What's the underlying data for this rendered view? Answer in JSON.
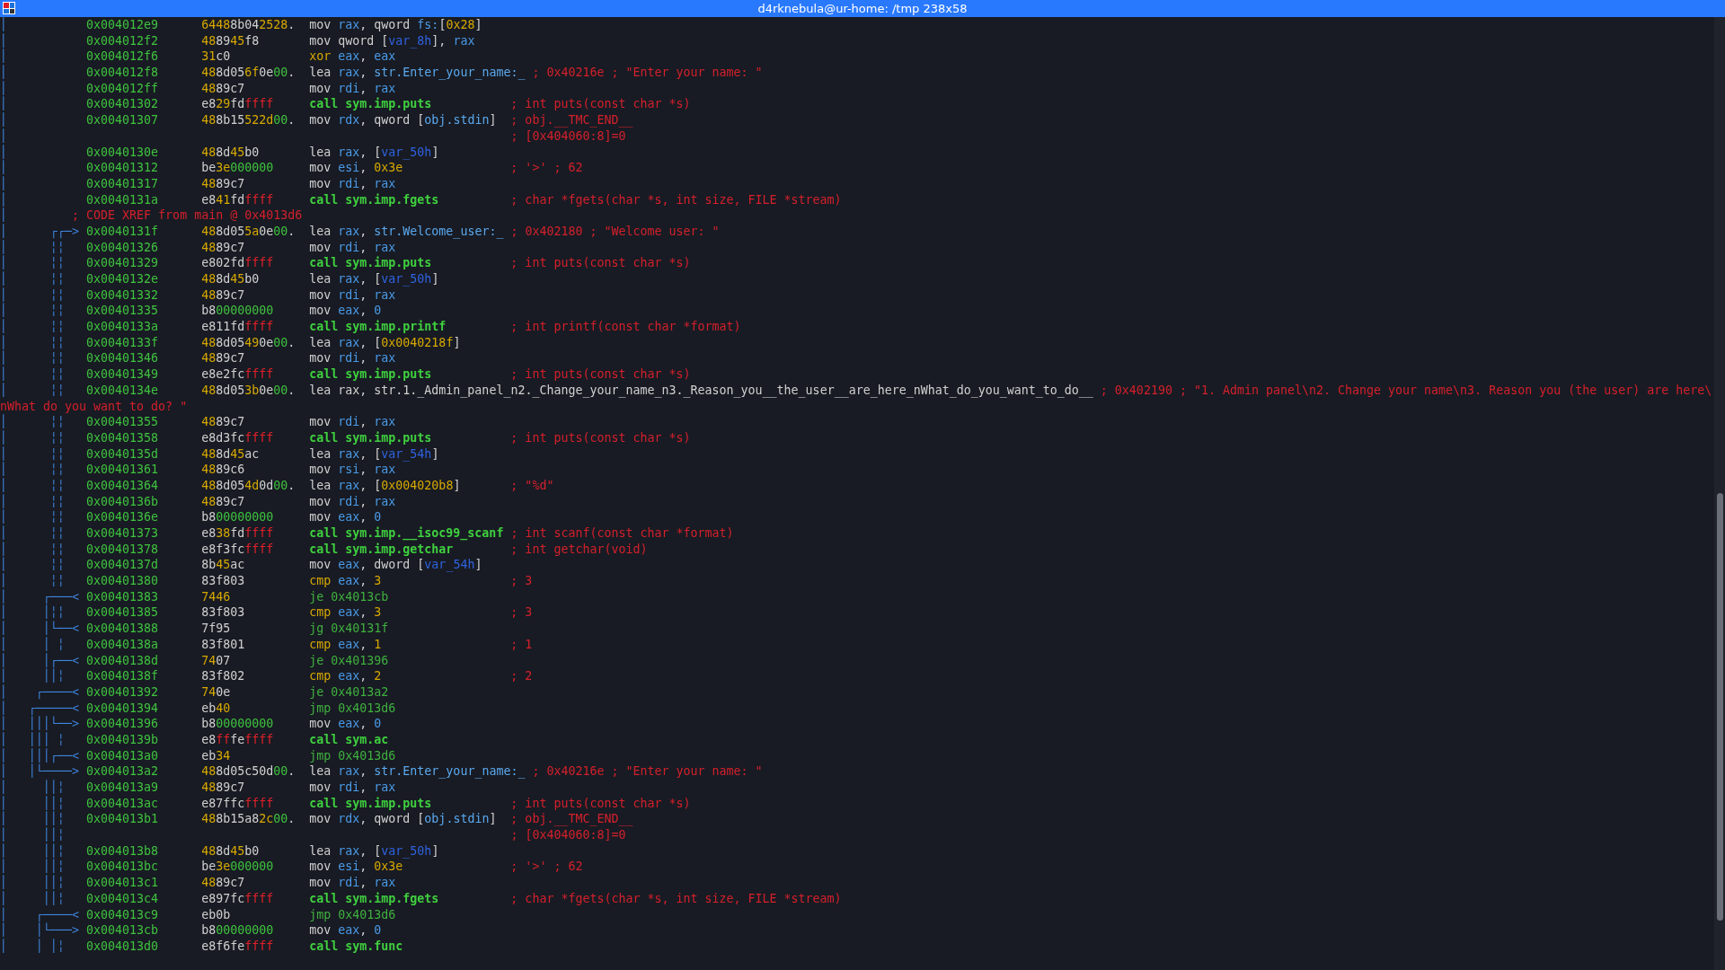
{
  "window": {
    "title": "d4rknebula@ur-home: /tmp 238x58"
  },
  "rows": [
    {
      "kind": "insn",
      "graph": "│",
      "address": "0x004012e9",
      "bytes": [
        {
          "text": "6448",
          "kind": "printable"
        },
        {
          "text": "8b04",
          "kind": "plain"
        },
        {
          "text": "2528",
          "kind": "printable"
        },
        {
          "text": ".",
          "kind": "plain"
        }
      ],
      "op": {
        "text": "mov",
        "kind": "plain"
      },
      "args": [
        {
          "text": "rax",
          "kind": "register"
        },
        {
          "text": ", qword ",
          "kind": "text"
        },
        {
          "text": "fs:",
          "kind": "register"
        },
        {
          "text": "[",
          "kind": "text"
        },
        {
          "text": "0x28",
          "kind": "number"
        },
        {
          "text": "]",
          "kind": "text"
        }
      ]
    },
    {
      "kind": "insn",
      "graph": "│",
      "address": "0x004012f2",
      "bytes": [
        {
          "text": "48",
          "kind": "printable"
        },
        {
          "text": "89",
          "kind": "plain"
        },
        {
          "text": "45",
          "kind": "printable"
        },
        {
          "text": "f8",
          "kind": "plain"
        }
      ],
      "op": {
        "text": "mov",
        "kind": "plain"
      },
      "args": [
        {
          "text": "qword [",
          "kind": "text"
        },
        {
          "text": "var_8h",
          "kind": "variable"
        },
        {
          "text": "], ",
          "kind": "text"
        },
        {
          "text": "rax",
          "kind": "register"
        }
      ]
    },
    {
      "kind": "insn",
      "graph": "│",
      "address": "0x004012f6",
      "bytes": [
        {
          "text": "31",
          "kind": "printable"
        },
        {
          "text": "c0",
          "kind": "plain"
        }
      ],
      "op": {
        "text": "xor",
        "kind": "compare"
      },
      "args": [
        {
          "text": "eax",
          "kind": "register"
        },
        {
          "text": ", ",
          "kind": "text"
        },
        {
          "text": "eax",
          "kind": "register"
        }
      ]
    },
    {
      "kind": "insn",
      "graph": "│",
      "address": "0x004012f8",
      "bytes": [
        {
          "text": "48",
          "kind": "printable"
        },
        {
          "text": "8d05",
          "kind": "plain"
        },
        {
          "text": "6f",
          "kind": "printable"
        },
        {
          "text": "0e",
          "kind": "plain"
        },
        {
          "text": "00",
          "kind": "zero"
        },
        {
          "text": ".",
          "kind": "plain"
        }
      ],
      "op": {
        "text": "lea",
        "kind": "plain"
      },
      "args": [
        {
          "text": "rax",
          "kind": "register"
        },
        {
          "text": ", ",
          "kind": "text"
        },
        {
          "text": "str.Enter_your_name:_",
          "kind": "symbol"
        }
      ],
      "comment": "; 0x40216e ; \"Enter your name: \""
    },
    {
      "kind": "insn",
      "graph": "│",
      "address": "0x004012ff",
      "bytes": [
        {
          "text": "48",
          "kind": "printable"
        },
        {
          "text": "89c7",
          "kind": "plain"
        }
      ],
      "op": {
        "text": "mov",
        "kind": "plain"
      },
      "args": [
        {
          "text": "rdi",
          "kind": "register"
        },
        {
          "text": ", ",
          "kind": "text"
        },
        {
          "text": "rax",
          "kind": "register"
        }
      ]
    },
    {
      "kind": "insn",
      "graph": "│",
      "address": "0x00401302",
      "bytes": [
        {
          "text": "e8",
          "kind": "plain"
        },
        {
          "text": "29",
          "kind": "printable"
        },
        {
          "text": "fd",
          "kind": "plain"
        },
        {
          "text": "ffff",
          "kind": "ff"
        }
      ],
      "op": {
        "text": "call",
        "kind": "call"
      },
      "args": [
        {
          "text": "sym.imp.puts",
          "kind": "call_target"
        }
      ],
      "comment": "; int puts(const char *s)"
    },
    {
      "kind": "insn",
      "graph": "│",
      "address": "0x00401307",
      "bytes": [
        {
          "text": "48",
          "kind": "printable"
        },
        {
          "text": "8b15",
          "kind": "plain"
        },
        {
          "text": "522d",
          "kind": "printable"
        },
        {
          "text": "00",
          "kind": "zero"
        },
        {
          "text": ".",
          "kind": "plain"
        }
      ],
      "op": {
        "text": "mov",
        "kind": "plain"
      },
      "args": [
        {
          "text": "rdx",
          "kind": "register"
        },
        {
          "text": ", qword [",
          "kind": "text"
        },
        {
          "text": "obj.stdin",
          "kind": "symbol"
        },
        {
          "text": "]",
          "kind": "text"
        }
      ],
      "comment": "; obj.__TMC_END__"
    },
    {
      "kind": "comment",
      "graph": "│",
      "comment": "; [0x404060:8]=0"
    },
    {
      "kind": "insn",
      "graph": "│",
      "address": "0x0040130e",
      "bytes": [
        {
          "text": "48",
          "kind": "printable"
        },
        {
          "text": "8d",
          "kind": "plain"
        },
        {
          "text": "45",
          "kind": "printable"
        },
        {
          "text": "b0",
          "kind": "plain"
        }
      ],
      "op": {
        "text": "lea",
        "kind": "plain"
      },
      "args": [
        {
          "text": "rax",
          "kind": "register"
        },
        {
          "text": ", [",
          "kind": "text"
        },
        {
          "text": "var_50h",
          "kind": "variable"
        },
        {
          "text": "]",
          "kind": "text"
        }
      ]
    },
    {
      "kind": "insn",
      "graph": "│",
      "address": "0x00401312",
      "bytes": [
        {
          "text": "be",
          "kind": "plain"
        },
        {
          "text": "3e",
          "kind": "printable"
        },
        {
          "text": "000000",
          "kind": "zero"
        }
      ],
      "op": {
        "text": "mov",
        "kind": "plain"
      },
      "args": [
        {
          "text": "esi",
          "kind": "register"
        },
        {
          "text": ", ",
          "kind": "text"
        },
        {
          "text": "0x3e",
          "kind": "number"
        }
      ],
      "comment": "; '>' ; 62"
    },
    {
      "kind": "insn",
      "graph": "│",
      "address": "0x00401317",
      "bytes": [
        {
          "text": "48",
          "kind": "printable"
        },
        {
          "text": "89c7",
          "kind": "plain"
        }
      ],
      "op": {
        "text": "mov",
        "kind": "plain"
      },
      "args": [
        {
          "text": "rdi",
          "kind": "register"
        },
        {
          "text": ", ",
          "kind": "text"
        },
        {
          "text": "rax",
          "kind": "register"
        }
      ]
    },
    {
      "kind": "insn",
      "graph": "│",
      "address": "0x0040131a",
      "bytes": [
        {
          "text": "e8",
          "kind": "plain"
        },
        {
          "text": "41",
          "kind": "printable"
        },
        {
          "text": "fd",
          "kind": "plain"
        },
        {
          "text": "ffff",
          "kind": "ff"
        }
      ],
      "op": {
        "text": "call",
        "kind": "call"
      },
      "args": [
        {
          "text": "sym.imp.fgets",
          "kind": "call_target"
        }
      ],
      "comment": "; char *fgets(char *s, int size, FILE *stream)"
    },
    {
      "kind": "xref",
      "graph": "│",
      "comment": "; CODE XREF from main @ 0x4013d6"
    },
    {
      "kind": "insn",
      "graph": "│      ┌┌─> ",
      "address": "0x0040131f",
      "bytes": [
        {
          "text": "48",
          "kind": "printable"
        },
        {
          "text": "8d05",
          "kind": "plain"
        },
        {
          "text": "5a",
          "kind": "printable"
        },
        {
          "text": "0e",
          "kind": "plain"
        },
        {
          "text": "00",
          "kind": "zero"
        },
        {
          "text": ".",
          "kind": "plain"
        }
      ],
      "op": {
        "text": "lea",
        "kind": "plain"
      },
      "args": [
        {
          "text": "rax",
          "kind": "register"
        },
        {
          "text": ", ",
          "kind": "text"
        },
        {
          "text": "str.Welcome_user:_",
          "kind": "symbol"
        }
      ],
      "comment": "; 0x402180 ; \"Welcome user: \""
    },
    {
      "kind": "insn",
      "graph": "│      ╎╎   ",
      "address": "0x00401326",
      "bytes": [
        {
          "text": "48",
          "kind": "printable"
        },
        {
          "text": "89c7",
          "kind": "plain"
        }
      ],
      "op": {
        "text": "mov",
        "kind": "plain"
      },
      "args": [
        {
          "text": "rdi",
          "kind": "register"
        },
        {
          "text": ", ",
          "kind": "text"
        },
        {
          "text": "rax",
          "kind": "register"
        }
      ]
    },
    {
      "kind": "insn",
      "graph": "│      ╎╎   ",
      "address": "0x00401329",
      "bytes": [
        {
          "text": "e802fd",
          "kind": "plain"
        },
        {
          "text": "ffff",
          "kind": "ff"
        }
      ],
      "op": {
        "text": "call",
        "kind": "call"
      },
      "args": [
        {
          "text": "sym.imp.puts",
          "kind": "call_target"
        }
      ],
      "comment": "; int puts(const char *s)"
    },
    {
      "kind": "insn",
      "graph": "│      ╎╎   ",
      "address": "0x0040132e",
      "bytes": [
        {
          "text": "48",
          "kind": "printable"
        },
        {
          "text": "8d",
          "kind": "plain"
        },
        {
          "text": "45",
          "kind": "printable"
        },
        {
          "text": "b0",
          "kind": "plain"
        }
      ],
      "op": {
        "text": "lea",
        "kind": "plain"
      },
      "args": [
        {
          "text": "rax",
          "kind": "register"
        },
        {
          "text": ", [",
          "kind": "text"
        },
        {
          "text": "var_50h",
          "kind": "variable"
        },
        {
          "text": "]",
          "kind": "text"
        }
      ]
    },
    {
      "kind": "insn",
      "graph": "│      ╎╎   ",
      "address": "0x00401332",
      "bytes": [
        {
          "text": "48",
          "kind": "printable"
        },
        {
          "text": "89c7",
          "kind": "plain"
        }
      ],
      "op": {
        "text": "mov",
        "kind": "plain"
      },
      "args": [
        {
          "text": "rdi",
          "kind": "register"
        },
        {
          "text": ", ",
          "kind": "text"
        },
        {
          "text": "rax",
          "kind": "register"
        }
      ]
    },
    {
      "kind": "insn",
      "graph": "│      ╎╎   ",
      "address": "0x00401335",
      "bytes": [
        {
          "text": "b8",
          "kind": "plain"
        },
        {
          "text": "00000000",
          "kind": "zero"
        }
      ],
      "op": {
        "text": "mov",
        "kind": "plain"
      },
      "args": [
        {
          "text": "eax",
          "kind": "register"
        },
        {
          "text": ", ",
          "kind": "text"
        },
        {
          "text": "0",
          "kind": "immediate"
        }
      ]
    },
    {
      "kind": "insn",
      "graph": "│      ╎╎   ",
      "address": "0x0040133a",
      "bytes": [
        {
          "text": "e811fd",
          "kind": "plain"
        },
        {
          "text": "ffff",
          "kind": "ff"
        }
      ],
      "op": {
        "text": "call",
        "kind": "call"
      },
      "args": [
        {
          "text": "sym.imp.printf",
          "kind": "call_target"
        }
      ],
      "comment": "; int printf(const char *format)"
    },
    {
      "kind": "insn",
      "graph": "│      ╎╎   ",
      "address": "0x0040133f",
      "bytes": [
        {
          "text": "48",
          "kind": "printable"
        },
        {
          "text": "8d05",
          "kind": "plain"
        },
        {
          "text": "49",
          "kind": "printable"
        },
        {
          "text": "0e",
          "kind": "plain"
        },
        {
          "text": "00",
          "kind": "zero"
        },
        {
          "text": ".",
          "kind": "plain"
        }
      ],
      "op": {
        "text": "lea",
        "kind": "plain"
      },
      "args": [
        {
          "text": "rax",
          "kind": "register"
        },
        {
          "text": ", [",
          "kind": "text"
        },
        {
          "text": "0x0040218f",
          "kind": "number"
        },
        {
          "text": "]",
          "kind": "text"
        }
      ]
    },
    {
      "kind": "insn",
      "graph": "│      ╎╎   ",
      "address": "0x00401346",
      "bytes": [
        {
          "text": "48",
          "kind": "printable"
        },
        {
          "text": "89c7",
          "kind": "plain"
        }
      ],
      "op": {
        "text": "mov",
        "kind": "plain"
      },
      "args": [
        {
          "text": "rdi",
          "kind": "register"
        },
        {
          "text": ", ",
          "kind": "text"
        },
        {
          "text": "rax",
          "kind": "register"
        }
      ]
    },
    {
      "kind": "insn",
      "graph": "│      ╎╎   ",
      "address": "0x00401349",
      "bytes": [
        {
          "text": "e8e2fc",
          "kind": "plain"
        },
        {
          "text": "ffff",
          "kind": "ff"
        }
      ],
      "op": {
        "text": "call",
        "kind": "call"
      },
      "args": [
        {
          "text": "sym.imp.puts",
          "kind": "call_target"
        }
      ],
      "comment": "; int puts(const char *s)"
    },
    {
      "kind": "insn",
      "graph": "│      ╎╎   ",
      "address": "0x0040134e",
      "bytes": [
        {
          "text": "48",
          "kind": "printable"
        },
        {
          "text": "8d05",
          "kind": "plain"
        },
        {
          "text": "3b",
          "kind": "printable"
        },
        {
          "text": "0e",
          "kind": "plain"
        },
        {
          "text": "00",
          "kind": "zero"
        },
        {
          "text": ".",
          "kind": "plain"
        }
      ],
      "op": {
        "text": "lea",
        "kind": "plain"
      },
      "args": [
        {
          "text": "rax, str.1._Admin_panel_n2._Change_your_name_n3._Reason_you__the_user__are_here_nWhat_do_you_want_to_do__",
          "kind": "text"
        }
      ],
      "comment": "; 0x402190 ; \"1. Admin panel\\n2. Change your name\\n3. Reason you (the user) are here\\"
    },
    {
      "kind": "wrap",
      "comment": "nWhat do you want to do? \""
    },
    {
      "kind": "insn",
      "graph": "│      ╎╎   ",
      "address": "0x00401355",
      "bytes": [
        {
          "text": "48",
          "kind": "printable"
        },
        {
          "text": "89c7",
          "kind": "plain"
        }
      ],
      "op": {
        "text": "mov",
        "kind": "plain"
      },
      "args": [
        {
          "text": "rdi",
          "kind": "register"
        },
        {
          "text": ", ",
          "kind": "text"
        },
        {
          "text": "rax",
          "kind": "register"
        }
      ]
    },
    {
      "kind": "insn",
      "graph": "│      ╎╎   ",
      "address": "0x00401358",
      "bytes": [
        {
          "text": "e8d3fc",
          "kind": "plain"
        },
        {
          "text": "ffff",
          "kind": "ff"
        }
      ],
      "op": {
        "text": "call",
        "kind": "call"
      },
      "args": [
        {
          "text": "sym.imp.puts",
          "kind": "call_target"
        }
      ],
      "comment": "; int puts(const char *s)"
    },
    {
      "kind": "insn",
      "graph": "│      ╎╎   ",
      "address": "0x0040135d",
      "bytes": [
        {
          "text": "48",
          "kind": "printable"
        },
        {
          "text": "8d",
          "kind": "plain"
        },
        {
          "text": "45",
          "kind": "printable"
        },
        {
          "text": "ac",
          "kind": "plain"
        }
      ],
      "op": {
        "text": "lea",
        "kind": "plain"
      },
      "args": [
        {
          "text": "rax",
          "kind": "register"
        },
        {
          "text": ", [",
          "kind": "text"
        },
        {
          "text": "var_54h",
          "kind": "variable"
        },
        {
          "text": "]",
          "kind": "text"
        }
      ]
    },
    {
      "kind": "insn",
      "graph": "│      ╎╎   ",
      "address": "0x00401361",
      "bytes": [
        {
          "text": "48",
          "kind": "printable"
        },
        {
          "text": "89c6",
          "kind": "plain"
        }
      ],
      "op": {
        "text": "mov",
        "kind": "plain"
      },
      "args": [
        {
          "text": "rsi",
          "kind": "register"
        },
        {
          "text": ", ",
          "kind": "text"
        },
        {
          "text": "rax",
          "kind": "register"
        }
      ]
    },
    {
      "kind": "insn",
      "graph": "│      ╎╎   ",
      "address": "0x00401364",
      "bytes": [
        {
          "text": "48",
          "kind": "printable"
        },
        {
          "text": "8d05",
          "kind": "plain"
        },
        {
          "text": "4d",
          "kind": "printable"
        },
        {
          "text": "0d",
          "kind": "plain"
        },
        {
          "text": "00",
          "kind": "zero"
        },
        {
          "text": ".",
          "kind": "plain"
        }
      ],
      "op": {
        "text": "lea",
        "kind": "plain"
      },
      "args": [
        {
          "text": "rax",
          "kind": "register"
        },
        {
          "text": ", [",
          "kind": "text"
        },
        {
          "text": "0x004020b8",
          "kind": "number"
        },
        {
          "text": "]",
          "kind": "text"
        }
      ],
      "comment": "; \"%d\""
    },
    {
      "kind": "insn",
      "graph": "│      ╎╎   ",
      "address": "0x0040136b",
      "bytes": [
        {
          "text": "48",
          "kind": "printable"
        },
        {
          "text": "89c7",
          "kind": "plain"
        }
      ],
      "op": {
        "text": "mov",
        "kind": "plain"
      },
      "args": [
        {
          "text": "rdi",
          "kind": "register"
        },
        {
          "text": ", ",
          "kind": "text"
        },
        {
          "text": "rax",
          "kind": "register"
        }
      ]
    },
    {
      "kind": "insn",
      "graph": "│      ╎╎   ",
      "address": "0x0040136e",
      "bytes": [
        {
          "text": "b8",
          "kind": "plain"
        },
        {
          "text": "00000000",
          "kind": "zero"
        }
      ],
      "op": {
        "text": "mov",
        "kind": "plain"
      },
      "args": [
        {
          "text": "eax",
          "kind": "register"
        },
        {
          "text": ", ",
          "kind": "text"
        },
        {
          "text": "0",
          "kind": "immediate"
        }
      ]
    },
    {
      "kind": "insn",
      "graph": "│      ╎╎   ",
      "address": "0x00401373",
      "bytes": [
        {
          "text": "e8",
          "kind": "plain"
        },
        {
          "text": "38",
          "kind": "printable"
        },
        {
          "text": "fd",
          "kind": "plain"
        },
        {
          "text": "ffff",
          "kind": "ff"
        }
      ],
      "op": {
        "text": "call",
        "kind": "call"
      },
      "args": [
        {
          "text": "sym.imp.__isoc99_scanf",
          "kind": "call_target"
        }
      ],
      "comment": "; int scanf(const char *format)"
    },
    {
      "kind": "insn",
      "graph": "│      ╎╎   ",
      "address": "0x00401378",
      "bytes": [
        {
          "text": "e8f3fc",
          "kind": "plain"
        },
        {
          "text": "ffff",
          "kind": "ff"
        }
      ],
      "op": {
        "text": "call",
        "kind": "call"
      },
      "args": [
        {
          "text": "sym.imp.getchar",
          "kind": "call_target"
        }
      ],
      "comment": "; int getchar(void)"
    },
    {
      "kind": "insn",
      "graph": "│      ╎╎   ",
      "address": "0x0040137d",
      "bytes": [
        {
          "text": "8b",
          "kind": "plain"
        },
        {
          "text": "45",
          "kind": "printable"
        },
        {
          "text": "ac",
          "kind": "plain"
        }
      ],
      "op": {
        "text": "mov",
        "kind": "plain"
      },
      "args": [
        {
          "text": "eax",
          "kind": "register"
        },
        {
          "text": ", dword [",
          "kind": "text"
        },
        {
          "text": "var_54h",
          "kind": "variable"
        },
        {
          "text": "]",
          "kind": "text"
        }
      ]
    },
    {
      "kind": "insn",
      "graph": "│      ╎╎   ",
      "address": "0x00401380",
      "bytes": [
        {
          "text": "83f803",
          "kind": "plain"
        }
      ],
      "op": {
        "text": "cmp",
        "kind": "compare"
      },
      "args": [
        {
          "text": "eax",
          "kind": "register"
        },
        {
          "text": ", ",
          "kind": "text"
        },
        {
          "text": "3",
          "kind": "number"
        }
      ],
      "comment": "; 3"
    },
    {
      "kind": "insn",
      "graph": "│     ┌───< ",
      "address": "0x00401383",
      "bytes": [
        {
          "text": "7446",
          "kind": "printable"
        }
      ],
      "op": {
        "text": "je",
        "kind": "jump"
      },
      "args": [
        {
          "text": "0x4013cb",
          "kind": "jump_target"
        }
      ]
    },
    {
      "kind": "insn",
      "graph": "│     │╎╎   ",
      "address": "0x00401385",
      "bytes": [
        {
          "text": "83f803",
          "kind": "plain"
        }
      ],
      "op": {
        "text": "cmp",
        "kind": "compare"
      },
      "args": [
        {
          "text": "eax",
          "kind": "register"
        },
        {
          "text": ", ",
          "kind": "text"
        },
        {
          "text": "3",
          "kind": "number"
        }
      ],
      "comment": "; 3"
    },
    {
      "kind": "insn",
      "graph": "│     │└──< ",
      "address": "0x00401388",
      "bytes": [
        {
          "text": "7f95",
          "kind": "plain"
        }
      ],
      "op": {
        "text": "jg",
        "kind": "jump"
      },
      "args": [
        {
          "text": "0x40131f",
          "kind": "jump_target"
        }
      ]
    },
    {
      "kind": "insn",
      "graph": "│     │ ╎   ",
      "address": "0x0040138a",
      "bytes": [
        {
          "text": "83f801",
          "kind": "plain"
        }
      ],
      "op": {
        "text": "cmp",
        "kind": "compare"
      },
      "args": [
        {
          "text": "eax",
          "kind": "register"
        },
        {
          "text": ", ",
          "kind": "text"
        },
        {
          "text": "1",
          "kind": "number"
        }
      ],
      "comment": "; 1"
    },
    {
      "kind": "insn",
      "graph": "│     │┌──< ",
      "address": "0x0040138d",
      "bytes": [
        {
          "text": "74",
          "kind": "printable"
        },
        {
          "text": "07",
          "kind": "plain"
        }
      ],
      "op": {
        "text": "je",
        "kind": "jump"
      },
      "args": [
        {
          "text": "0x401396",
          "kind": "jump_target"
        }
      ]
    },
    {
      "kind": "insn",
      "graph": "│     ││╎   ",
      "address": "0x0040138f",
      "bytes": [
        {
          "text": "83f802",
          "kind": "plain"
        }
      ],
      "op": {
        "text": "cmp",
        "kind": "compare"
      },
      "args": [
        {
          "text": "eax",
          "kind": "register"
        },
        {
          "text": ", ",
          "kind": "text"
        },
        {
          "text": "2",
          "kind": "number"
        }
      ],
      "comment": "; 2"
    },
    {
      "kind": "insn",
      "graph": "│    ┌────< ",
      "address": "0x00401392",
      "bytes": [
        {
          "text": "74",
          "kind": "printable"
        },
        {
          "text": "0e",
          "kind": "plain"
        }
      ],
      "op": {
        "text": "je",
        "kind": "jump"
      },
      "args": [
        {
          "text": "0x4013a2",
          "kind": "jump_target"
        }
      ]
    },
    {
      "kind": "insn",
      "graph": "│   ┌─────< ",
      "address": "0x00401394",
      "bytes": [
        {
          "text": "eb",
          "kind": "plain"
        },
        {
          "text": "40",
          "kind": "printable"
        }
      ],
      "op": {
        "text": "jmp",
        "kind": "jump"
      },
      "args": [
        {
          "text": "0x4013d6",
          "kind": "jump_target"
        }
      ]
    },
    {
      "kind": "insn",
      "graph": "│   │││└──> ",
      "address": "0x00401396",
      "bytes": [
        {
          "text": "b8",
          "kind": "plain"
        },
        {
          "text": "00000000",
          "kind": "zero"
        }
      ],
      "op": {
        "text": "mov",
        "kind": "plain"
      },
      "args": [
        {
          "text": "eax",
          "kind": "register"
        },
        {
          "text": ", ",
          "kind": "text"
        },
        {
          "text": "0",
          "kind": "immediate"
        }
      ]
    },
    {
      "kind": "insn",
      "graph": "│   │││ ╎   ",
      "address": "0x0040139b",
      "bytes": [
        {
          "text": "e8",
          "kind": "plain"
        },
        {
          "text": "ff",
          "kind": "ff"
        },
        {
          "text": "fe",
          "kind": "plain"
        },
        {
          "text": "ffff",
          "kind": "ff"
        }
      ],
      "op": {
        "text": "call",
        "kind": "call"
      },
      "args": [
        {
          "text": "sym.ac",
          "kind": "call_target"
        }
      ]
    },
    {
      "kind": "insn",
      "graph": "│   │││┌──< ",
      "address": "0x004013a0",
      "bytes": [
        {
          "text": "eb",
          "kind": "plain"
        },
        {
          "text": "34",
          "kind": "printable"
        }
      ],
      "op": {
        "text": "jmp",
        "kind": "jump"
      },
      "args": [
        {
          "text": "0x4013d6",
          "kind": "jump_target"
        }
      ]
    },
    {
      "kind": "insn",
      "graph": "│   │└────> ",
      "address": "0x004013a2",
      "bytes": [
        {
          "text": "48",
          "kind": "printable"
        },
        {
          "text": "8d05c50d",
          "kind": "plain"
        },
        {
          "text": "00",
          "kind": "zero"
        },
        {
          "text": ".",
          "kind": "plain"
        }
      ],
      "op": {
        "text": "lea",
        "kind": "plain"
      },
      "args": [
        {
          "text": "rax",
          "kind": "register"
        },
        {
          "text": ", ",
          "kind": "text"
        },
        {
          "text": "str.Enter_your_name:_",
          "kind": "symbol"
        }
      ],
      "comment": "; 0x40216e ; \"Enter your name: \""
    },
    {
      "kind": "insn",
      "graph": "│     ││╎   ",
      "address": "0x004013a9",
      "bytes": [
        {
          "text": "48",
          "kind": "printable"
        },
        {
          "text": "89c7",
          "kind": "plain"
        }
      ],
      "op": {
        "text": "mov",
        "kind": "plain"
      },
      "args": [
        {
          "text": "rdi",
          "kind": "register"
        },
        {
          "text": ", ",
          "kind": "text"
        },
        {
          "text": "rax",
          "kind": "register"
        }
      ]
    },
    {
      "kind": "insn",
      "graph": "│     ││╎   ",
      "address": "0x004013ac",
      "bytes": [
        {
          "text": "e87ffc",
          "kind": "plain"
        },
        {
          "text": "ffff",
          "kind": "ff"
        }
      ],
      "op": {
        "text": "call",
        "kind": "call"
      },
      "args": [
        {
          "text": "sym.imp.puts",
          "kind": "call_target"
        }
      ],
      "comment": "; int puts(const char *s)"
    },
    {
      "kind": "insn",
      "graph": "│     ││╎   ",
      "address": "0x004013b1",
      "bytes": [
        {
          "text": "48",
          "kind": "printable"
        },
        {
          "text": "8b15a8",
          "kind": "plain"
        },
        {
          "text": "2c",
          "kind": "printable"
        },
        {
          "text": "00",
          "kind": "zero"
        },
        {
          "text": ".",
          "kind": "plain"
        }
      ],
      "op": {
        "text": "mov",
        "kind": "plain"
      },
      "args": [
        {
          "text": "rdx",
          "kind": "register"
        },
        {
          "text": ", qword [",
          "kind": "text"
        },
        {
          "text": "obj.stdin",
          "kind": "symbol"
        },
        {
          "text": "]",
          "kind": "text"
        }
      ],
      "comment": "; obj.__TMC_END__"
    },
    {
      "kind": "comment",
      "graph": "│     ││╎   ",
      "comment": "; [0x404060:8]=0"
    },
    {
      "kind": "insn",
      "graph": "│     ││╎   ",
      "address": "0x004013b8",
      "bytes": [
        {
          "text": "48",
          "kind": "printable"
        },
        {
          "text": "8d",
          "kind": "plain"
        },
        {
          "text": "45",
          "kind": "printable"
        },
        {
          "text": "b0",
          "kind": "plain"
        }
      ],
      "op": {
        "text": "lea",
        "kind": "plain"
      },
      "args": [
        {
          "text": "rax",
          "kind": "register"
        },
        {
          "text": ", [",
          "kind": "text"
        },
        {
          "text": "var_50h",
          "kind": "variable"
        },
        {
          "text": "]",
          "kind": "text"
        }
      ]
    },
    {
      "kind": "insn",
      "graph": "│     ││╎   ",
      "address": "0x004013bc",
      "bytes": [
        {
          "text": "be",
          "kind": "plain"
        },
        {
          "text": "3e",
          "kind": "printable"
        },
        {
          "text": "000000",
          "kind": "zero"
        }
      ],
      "op": {
        "text": "mov",
        "kind": "plain"
      },
      "args": [
        {
          "text": "esi",
          "kind": "register"
        },
        {
          "text": ", ",
          "kind": "text"
        },
        {
          "text": "0x3e",
          "kind": "number"
        }
      ],
      "comment": "; '>' ; 62"
    },
    {
      "kind": "insn",
      "graph": "│     ││╎   ",
      "address": "0x004013c1",
      "bytes": [
        {
          "text": "48",
          "kind": "printable"
        },
        {
          "text": "89c7",
          "kind": "plain"
        }
      ],
      "op": {
        "text": "mov",
        "kind": "plain"
      },
      "args": [
        {
          "text": "rdi",
          "kind": "register"
        },
        {
          "text": ", ",
          "kind": "text"
        },
        {
          "text": "rax",
          "kind": "register"
        }
      ]
    },
    {
      "kind": "insn",
      "graph": "│     ││╎   ",
      "address": "0x004013c4",
      "bytes": [
        {
          "text": "e897fc",
          "kind": "plain"
        },
        {
          "text": "ffff",
          "kind": "ff"
        }
      ],
      "op": {
        "text": "call",
        "kind": "call"
      },
      "args": [
        {
          "text": "sym.imp.fgets",
          "kind": "call_target"
        }
      ],
      "comment": "; char *fgets(char *s, int size, FILE *stream)"
    },
    {
      "kind": "insn",
      "graph": "│    ┌────< ",
      "address": "0x004013c9",
      "bytes": [
        {
          "text": "eb0b",
          "kind": "plain"
        }
      ],
      "op": {
        "text": "jmp",
        "kind": "jump"
      },
      "args": [
        {
          "text": "0x4013d6",
          "kind": "jump_target"
        }
      ]
    },
    {
      "kind": "insn",
      "graph": "│    │└───> ",
      "address": "0x004013cb",
      "bytes": [
        {
          "text": "b8",
          "kind": "plain"
        },
        {
          "text": "00000000",
          "kind": "zero"
        }
      ],
      "op": {
        "text": "mov",
        "kind": "plain"
      },
      "args": [
        {
          "text": "eax",
          "kind": "register"
        },
        {
          "text": ", ",
          "kind": "text"
        },
        {
          "text": "0",
          "kind": "immediate"
        }
      ]
    },
    {
      "kind": "insn",
      "graph": "│    │ │╎   ",
      "address": "0x004013d0",
      "bytes": [
        {
          "text": "e8f6fe",
          "kind": "plain"
        },
        {
          "text": "ffff",
          "kind": "ff"
        }
      ],
      "op": {
        "text": "call",
        "kind": "call"
      },
      "args": [
        {
          "text": "sym.func",
          "kind": "call_target"
        }
      ]
    }
  ]
}
